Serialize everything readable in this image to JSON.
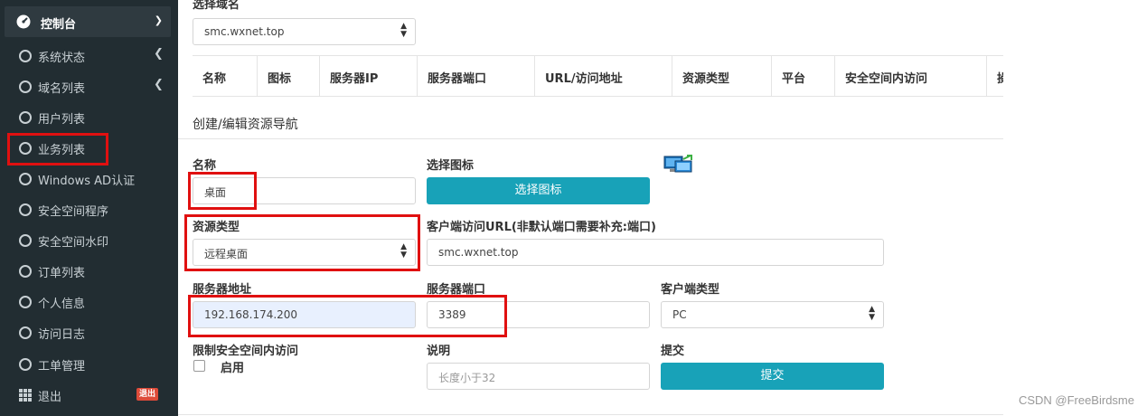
{
  "sidebar": {
    "header": {
      "label": "控制台",
      "icon": "dashboard-icon"
    },
    "items": [
      {
        "label": "系统状态",
        "has_arrow": true
      },
      {
        "label": "域名列表",
        "has_arrow": true
      },
      {
        "label": "用户列表",
        "has_arrow": false
      },
      {
        "label": "业务列表",
        "has_arrow": false
      },
      {
        "label": "Windows AD认证",
        "has_arrow": false
      },
      {
        "label": "安全空间程序",
        "has_arrow": false
      },
      {
        "label": "安全空间水印",
        "has_arrow": false
      },
      {
        "label": "订单列表",
        "has_arrow": false
      },
      {
        "label": "个人信息",
        "has_arrow": false
      },
      {
        "label": "访问日志",
        "has_arrow": false
      },
      {
        "label": "工单管理",
        "has_arrow": false
      }
    ],
    "logout": {
      "label": "退出",
      "badge": "退出"
    },
    "bg_color": "#222d32"
  },
  "domain_select": {
    "label": "选择域名",
    "value": "smc.wxnet.top"
  },
  "table": {
    "columns": [
      "名称",
      "图标",
      "服务器IP",
      "服务器端口",
      "URL/访问地址",
      "资源类型",
      "平台",
      "安全空间内访问",
      "操"
    ]
  },
  "form": {
    "title": "创建/编辑资源导航",
    "name": {
      "label": "名称",
      "value": "桌面"
    },
    "icon": {
      "label": "选择图标",
      "button": "选择图标",
      "preview": "remote-desktop-icon"
    },
    "resource_type": {
      "label": "资源类型",
      "value": "远程桌面"
    },
    "client_url": {
      "label": "客户端访问URL(非默认端口需要补充:端口)",
      "value": "smc.wxnet.top"
    },
    "server_address": {
      "label": "服务器地址",
      "value": "192.168.174.200"
    },
    "server_port": {
      "label": "服务器端口",
      "value": "3389"
    },
    "client_type": {
      "label": "客户端类型",
      "value": "PC"
    },
    "restrict": {
      "label": "限制安全空间内访问",
      "checkbox_label": "启用"
    },
    "description": {
      "label": "说明",
      "placeholder": "长度小于32"
    },
    "submit": {
      "label": "提交",
      "button": "提交"
    }
  },
  "accent_color": "#18a2b8",
  "watermark": "CSDN @FreeBirdsme"
}
